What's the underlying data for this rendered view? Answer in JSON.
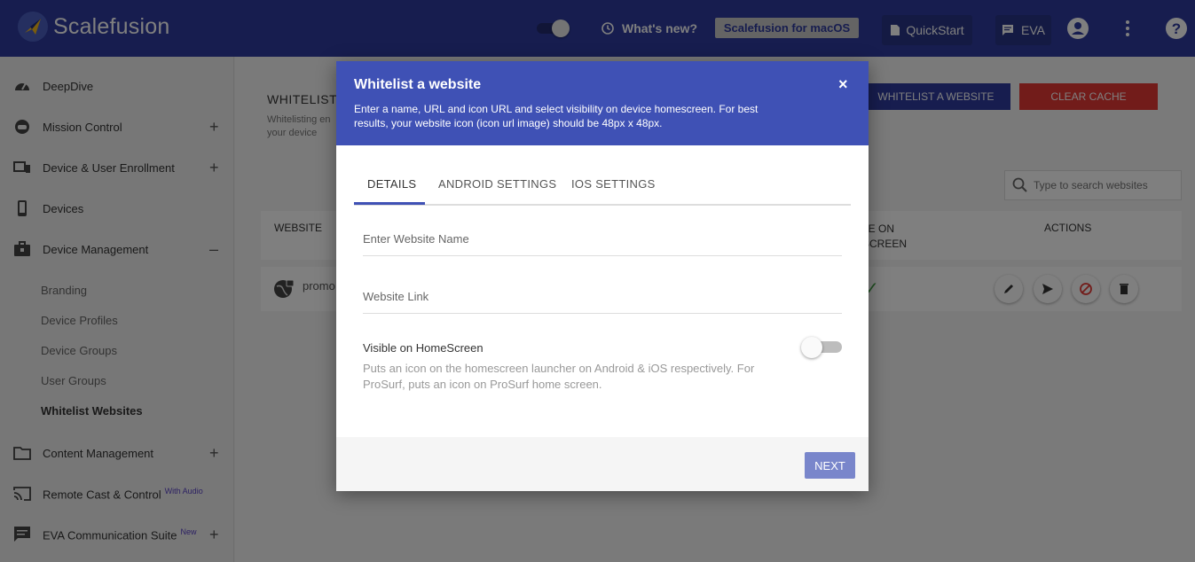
{
  "app": {
    "brand": "Scalefusion"
  },
  "topbar": {
    "whats_new": "What's new?",
    "macos": "Scalefusion for macOS",
    "quickstart": "QuickStart",
    "eva": "EVA"
  },
  "sidebar": {
    "items": [
      {
        "label": "DeepDive",
        "icon": "speedometer-icon"
      },
      {
        "label": "Mission Control",
        "icon": "robot-icon",
        "expand": "+"
      },
      {
        "label": "Device & User Enrollment",
        "icon": "devices-icon",
        "expand": "+"
      },
      {
        "label": "Devices",
        "icon": "phone-icon"
      },
      {
        "label": "Device Management",
        "icon": "briefcase-icon",
        "expand": "–"
      },
      {
        "label": "Content Management",
        "icon": "folder-icon",
        "expand": "+"
      },
      {
        "label": "Remote Cast & Control",
        "icon": "cast-icon",
        "badge": "With Audio"
      },
      {
        "label": "EVA Communication Suite",
        "icon": "chat-icon",
        "badge": "New",
        "expand": "+"
      }
    ],
    "sub_items": [
      "Branding",
      "Device Profiles",
      "Device Groups",
      "User Groups",
      "Whitelist Websites"
    ]
  },
  "page": {
    "title": "WHITELIST W",
    "desc": "Whitelisting en your device",
    "btn_whitelist": "WHITELIST A WEBSITE",
    "btn_clear": "CLEAR CACHE",
    "search_placeholder": "Type to search websites",
    "table": {
      "col_website": "WEBSITE",
      "col_visible": "BLE ON ESCREEN",
      "col_actions": "ACTIONS",
      "rows": [
        {
          "name": "promo",
          "visible": "✓"
        }
      ]
    }
  },
  "modal": {
    "title": "Whitelist a website",
    "subtitle": "Enter a name, URL and icon URL and select visibility on device homescreen. For best results, your website icon (icon url image) should be 48px x 48px.",
    "close": "×",
    "tabs": [
      "DETAILS",
      "ANDROID SETTINGS",
      "IOS SETTINGS"
    ],
    "name_placeholder": "Enter Website Name",
    "link_placeholder": "Website Link",
    "visible_title": "Visible on HomeScreen",
    "visible_desc": "Puts an icon on the homescreen launcher on Android & iOS respectively. For ProSurf, puts an icon on ProSurf home screen.",
    "visible_on": false,
    "next": "NEXT"
  },
  "colors": {
    "topbar": "#2e3b9e",
    "modal_header": "#3f51b5",
    "danger": "#e53935",
    "next_button": "#7986cb"
  }
}
